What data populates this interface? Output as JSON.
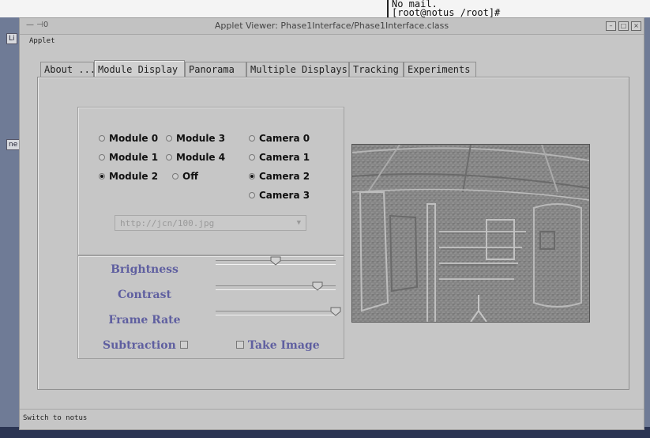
{
  "background": {
    "terminal_lines": "No mail.\n[root@notus /root]#",
    "left_labels": [
      "Li",
      "ne"
    ]
  },
  "window": {
    "title": "Applet Viewer: Phase1Interface/Phase1Interface.class",
    "title_left": "— ⊣0",
    "menu": [
      "Applet"
    ],
    "status": "Switch to notus"
  },
  "tabs": [
    {
      "label": "About ...",
      "active": false
    },
    {
      "label": "Module Display",
      "active": true
    },
    {
      "label": "Panorama",
      "active": false
    },
    {
      "label": "Multiple Displays",
      "active": false
    },
    {
      "label": "Tracking",
      "active": false
    },
    {
      "label": "Experiments",
      "active": false
    }
  ],
  "modules": [
    {
      "label": "Module 0",
      "selected": false
    },
    {
      "label": "Module 1",
      "selected": false
    },
    {
      "label": "Module 2",
      "selected": true
    },
    {
      "label": "Module 3",
      "selected": false
    },
    {
      "label": "Module 4",
      "selected": false
    },
    {
      "label": "Off",
      "selected": false
    }
  ],
  "cameras": [
    {
      "label": "Camera 0",
      "selected": false
    },
    {
      "label": "Camera 1",
      "selected": false
    },
    {
      "label": "Camera 2",
      "selected": true
    },
    {
      "label": "Camera 3",
      "selected": false
    }
  ],
  "url_select": {
    "value": "http://jcn/100.jpg"
  },
  "sliders": [
    {
      "label": "Brightness",
      "value": 0.5
    },
    {
      "label": "Contrast",
      "value": 0.85
    },
    {
      "label": "Frame Rate",
      "value": 1.0
    }
  ],
  "checkboxes": {
    "subtraction": {
      "label": "Subtraction",
      "checked": false
    },
    "take_image": {
      "label": "Take Image",
      "checked": false
    }
  },
  "colors": {
    "label_accent": "#5f5fa0"
  }
}
